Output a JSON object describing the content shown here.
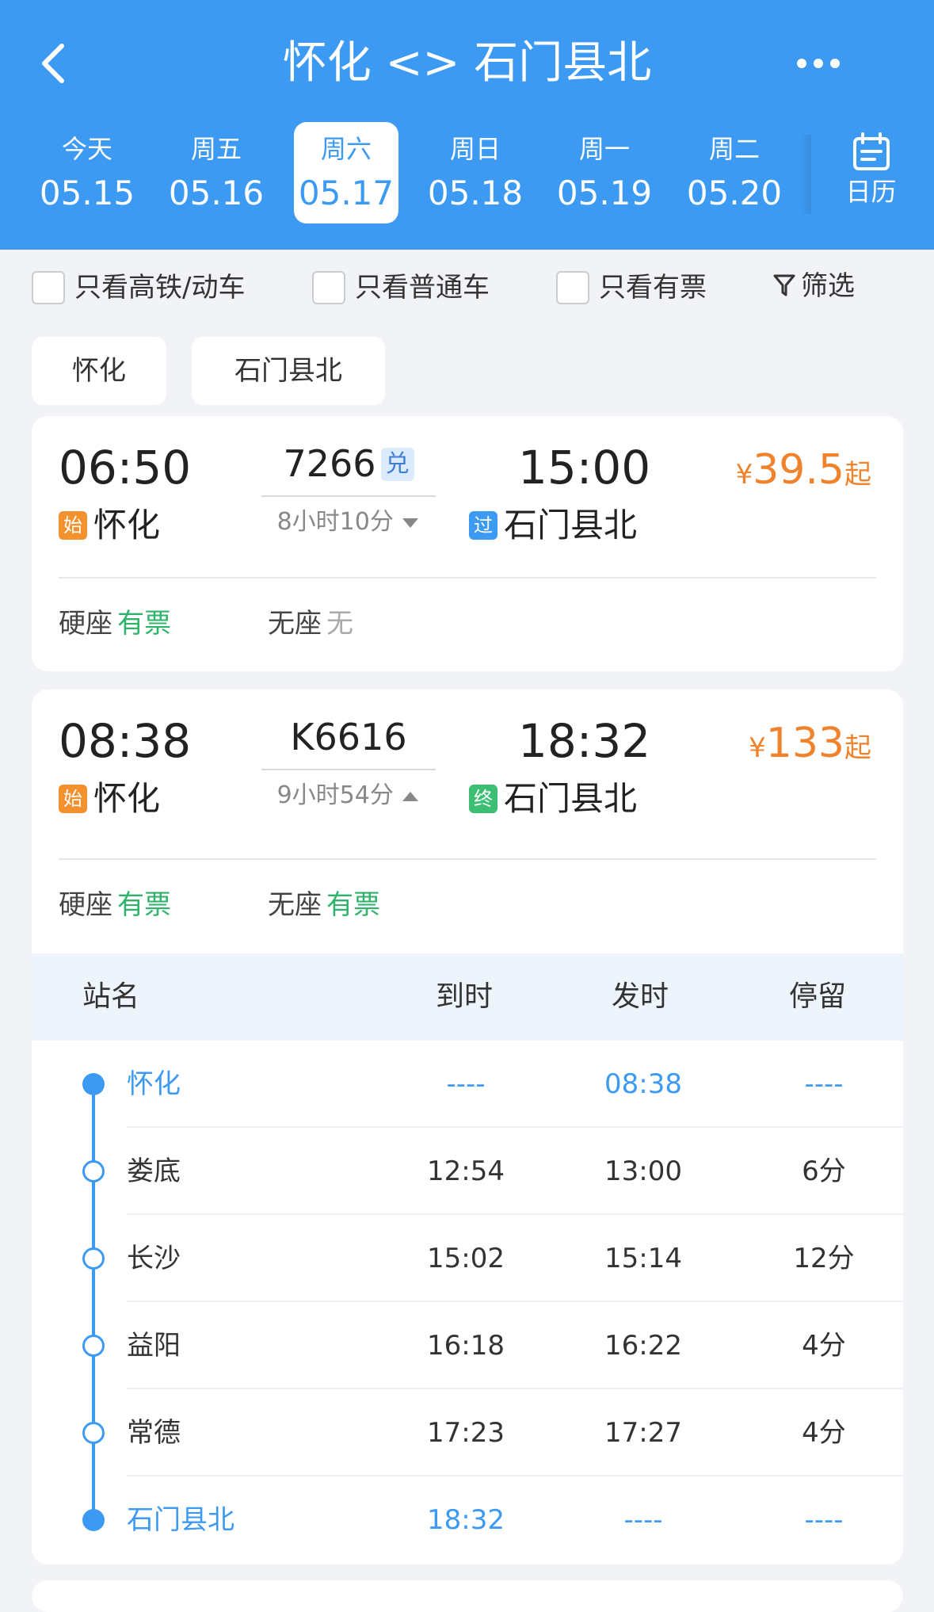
{
  "header": {
    "title": "怀化 <> 石门县北",
    "dates": [
      {
        "weekday": "今天",
        "date": "05.15",
        "selected": false
      },
      {
        "weekday": "周五",
        "date": "05.16",
        "selected": false
      },
      {
        "weekday": "周六",
        "date": "05.17",
        "selected": true
      },
      {
        "weekday": "周日",
        "date": "05.18",
        "selected": false
      },
      {
        "weekday": "周一",
        "date": "05.19",
        "selected": false
      },
      {
        "weekday": "周二",
        "date": "05.20",
        "selected": false
      }
    ],
    "calendar_label": "日历"
  },
  "filters": {
    "high_speed": "只看高铁/动车",
    "normal": "只看普通车",
    "available": "只看有票",
    "filter_label": "筛选"
  },
  "station_filters": {
    "from": "怀化",
    "to": "石门县北"
  },
  "trains": [
    {
      "depart_time": "06:50",
      "depart_tag": "始",
      "depart_station": "怀化",
      "train_no": "7266",
      "badge": "兑",
      "duration": "8小时10分",
      "arrive_time": "15:00",
      "arrive_tag": "过",
      "arrive_station": "石门县北",
      "price_currency": "¥",
      "price": "39.5",
      "price_suffix": "起",
      "seats": [
        {
          "type": "硬座",
          "status": "有票"
        },
        {
          "type": "无座",
          "status": "无"
        }
      ]
    },
    {
      "depart_time": "08:38",
      "depart_tag": "始",
      "depart_station": "怀化",
      "train_no": "K6616",
      "duration": "9小时54分",
      "arrive_time": "18:32",
      "arrive_tag": "终",
      "arrive_station": "石门县北",
      "price_currency": "¥",
      "price": "133",
      "price_suffix": "起",
      "seats": [
        {
          "type": "硬座",
          "status": "有票"
        },
        {
          "type": "无座",
          "status": "有票"
        }
      ],
      "stops_header": {
        "name": "站名",
        "arrive": "到时",
        "depart": "发时",
        "stay": "停留"
      },
      "stops": [
        {
          "name": "怀化",
          "arrive": "----",
          "depart": "08:38",
          "stay": "----"
        },
        {
          "name": "娄底",
          "arrive": "12:54",
          "depart": "13:00",
          "stay": "6分"
        },
        {
          "name": "长沙",
          "arrive": "15:02",
          "depart": "15:14",
          "stay": "12分"
        },
        {
          "name": "益阳",
          "arrive": "16:18",
          "depart": "16:22",
          "stay": "4分"
        },
        {
          "name": "常德",
          "arrive": "17:23",
          "depart": "17:27",
          "stay": "4分"
        },
        {
          "name": "石门县北",
          "arrive": "18:32",
          "depart": "----",
          "stay": "----"
        }
      ]
    }
  ],
  "colors": {
    "primary": "#3d9af2",
    "price": "#f0822c",
    "available": "#2fb36a"
  }
}
